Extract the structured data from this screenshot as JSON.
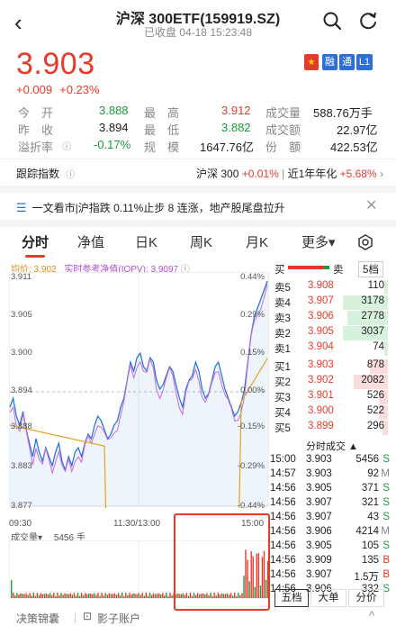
{
  "header": {
    "title": "沪深 300ETF(159919.SZ)",
    "subtitle": "已收盘  04-18 15:23:48"
  },
  "quote": {
    "price": "3.903",
    "change_abs": "+0.009",
    "change_pct": "+0.23%",
    "tags": [
      "融",
      "通",
      "L1"
    ]
  },
  "stats": {
    "open_label": "今　开",
    "open": "3.888",
    "high_label": "最　高",
    "high": "3.912",
    "volume_label": "成交量",
    "volume": "588.76万手",
    "prev_label": "昨　收",
    "prev": "3.894",
    "low_label": "最　低",
    "low": "3.882",
    "amount_label": "成交额",
    "amount": "22.97亿",
    "premium_label": "溢折率",
    "premium": "-0.17%",
    "scale_label": "规　模",
    "scale": "1647.76亿",
    "shares_label": "份　额",
    "shares": "422.53亿"
  },
  "tracking": {
    "label": "跟踪指数",
    "index_name": "沪深 300",
    "index_change": "+0.01%",
    "annual_label": "近1年年化",
    "annual": "+5.68%"
  },
  "news": {
    "text": "一文看市|沪指跌 0.11%止步 8 连涨，地产股尾盘拉升"
  },
  "tabs": [
    "分时",
    "净值",
    "日K",
    "周K",
    "月K",
    "更多▾"
  ],
  "chart": {
    "legend_avg": "均价: 3.902",
    "legend_iopv": "实时参考净值(IOPV): 3.9097",
    "y_labels": [
      "3.911",
      "3.905",
      "3.900",
      "3.894",
      "3.888",
      "3.883",
      "3.877"
    ],
    "pct_labels": [
      "0.44%",
      "0.29%",
      "0.15%",
      "0.00%",
      "-0.15%",
      "-0.29%",
      "-0.44%"
    ],
    "x_labels": [
      "09:30",
      "11:30/13:00",
      "15:00"
    ],
    "volume_label": "成交量▾",
    "volume_value": "5456 手",
    "colors": {
      "price": "#1f6fd8",
      "avg": "#e0a21a",
      "iopv": "#c86ae0",
      "up": "#e8392b",
      "down": "#1a9c3a"
    }
  },
  "order_book": {
    "header_buy": "买",
    "header_sell": "卖",
    "header_level": "5档",
    "asks": [
      {
        "label": "卖5",
        "price": "3.908",
        "vol": "110"
      },
      {
        "label": "卖4",
        "price": "3.907",
        "vol": "3178"
      },
      {
        "label": "卖3",
        "price": "3.906",
        "vol": "2778"
      },
      {
        "label": "卖2",
        "price": "3.905",
        "vol": "3037"
      },
      {
        "label": "卖1",
        "price": "3.904",
        "vol": "74"
      }
    ],
    "bids": [
      {
        "label": "买1",
        "price": "3.903",
        "vol": "878"
      },
      {
        "label": "买2",
        "price": "3.902",
        "vol": "2082"
      },
      {
        "label": "买3",
        "price": "3.901",
        "vol": "526"
      },
      {
        "label": "买4",
        "price": "3.900",
        "vol": "522"
      },
      {
        "label": "买5",
        "price": "3.899",
        "vol": "296"
      }
    ],
    "trades_header": "分时成交 ▲",
    "trades": [
      {
        "t": "15:00",
        "p": "3.903",
        "v": "5456",
        "s": "S"
      },
      {
        "t": "14:57",
        "p": "3.903",
        "v": "92",
        "s": "M"
      },
      {
        "t": "14:56",
        "p": "3.905",
        "v": "371",
        "s": "S"
      },
      {
        "t": "14:56",
        "p": "3.907",
        "v": "321",
        "s": "S"
      },
      {
        "t": "14:56",
        "p": "3.907",
        "v": "43",
        "s": "S"
      },
      {
        "t": "14:56",
        "p": "3.906",
        "v": "4214",
        "s": "M"
      },
      {
        "t": "14:56",
        "p": "3.905",
        "v": "105",
        "s": "S"
      },
      {
        "t": "14:56",
        "p": "3.909",
        "v": "135",
        "s": "B"
      },
      {
        "t": "14:56",
        "p": "3.907",
        "v": "1.5万",
        "s": "B"
      },
      {
        "t": "14:56",
        "p": "3.906",
        "v": "332",
        "s": "S"
      }
    ],
    "bottom_tabs": [
      "五档",
      "大单",
      "分价"
    ]
  },
  "footer": {
    "left": "决策锦囊",
    "right": "影子账户"
  }
}
